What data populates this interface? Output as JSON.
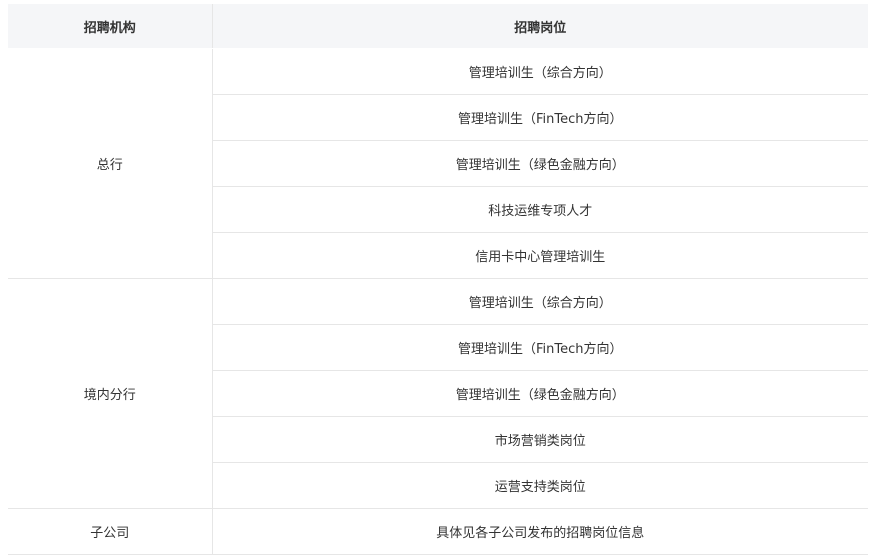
{
  "table": {
    "headers": {
      "org": "招聘机构",
      "position": "招聘岗位"
    },
    "groups": [
      {
        "org": "总行",
        "positions": [
          "管理培训生（综合方向）",
          "管理培训生（FinTech方向）",
          "管理培训生（绿色金融方向）",
          "科技运维专项人才",
          "信用卡中心管理培训生"
        ]
      },
      {
        "org": "境内分行",
        "positions": [
          "管理培训生（综合方向）",
          "管理培训生（FinTech方向）",
          "管理培训生（绿色金融方向）",
          "市场营销类岗位",
          "运营支持类岗位"
        ]
      },
      {
        "org": "子公司",
        "positions": [
          "具体见各子公司发布的招聘岗位信息"
        ]
      }
    ]
  }
}
